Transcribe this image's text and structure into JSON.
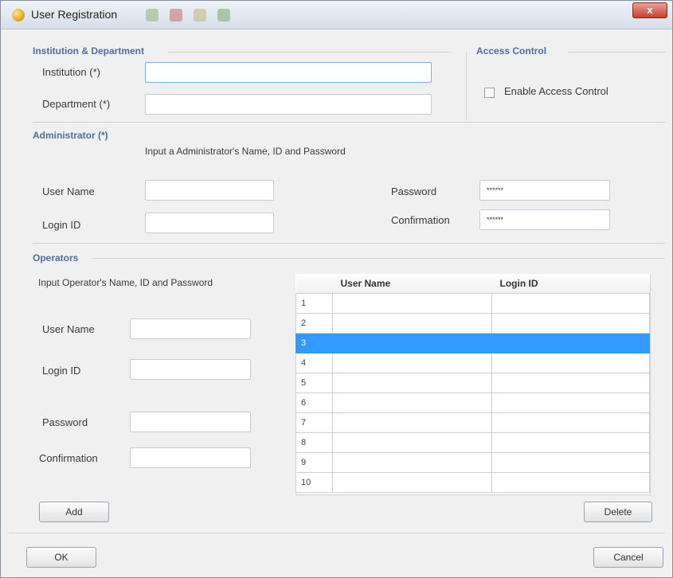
{
  "window": {
    "title": "User Registration",
    "close_label": "x"
  },
  "institution_dept": {
    "group_label": "Institution & Department",
    "institution_label": "Institution (*)",
    "institution_value": "",
    "department_label": "Department (*)",
    "department_value": ""
  },
  "access_control": {
    "group_label": "Access Control",
    "enable_label": "Enable Access Control",
    "checked": false
  },
  "administrator": {
    "group_label": "Administrator (*)",
    "hint": "Input a Administrator's Name, ID and Password",
    "username_label": "User Name",
    "loginid_label": "Login ID",
    "password_label": "Password",
    "confirmation_label": "Confirmation",
    "password_value": "******",
    "confirmation_value": "******"
  },
  "operators": {
    "group_label": "Operators",
    "hint": "Input Operator's Name, ID and Password",
    "username_label": "User Name",
    "loginid_label": "Login ID",
    "password_label": "Password",
    "confirmation_label": "Confirmation",
    "add_label": "Add",
    "delete_label": "Delete",
    "table": {
      "columns": [
        "User Name",
        "Login ID"
      ],
      "rows": [
        {
          "num": "1",
          "user": "",
          "login": ""
        },
        {
          "num": "2",
          "user": "",
          "login": ""
        },
        {
          "num": "3",
          "user": "",
          "login": ""
        },
        {
          "num": "4",
          "user": "",
          "login": ""
        },
        {
          "num": "5",
          "user": "",
          "login": ""
        },
        {
          "num": "6",
          "user": "",
          "login": ""
        },
        {
          "num": "7",
          "user": "",
          "login": ""
        },
        {
          "num": "8",
          "user": "",
          "login": ""
        },
        {
          "num": "9",
          "user": "",
          "login": ""
        },
        {
          "num": "10",
          "user": "",
          "login": ""
        }
      ],
      "selected_row": "3"
    }
  },
  "footer": {
    "ok_label": "OK",
    "cancel_label": "Cancel"
  }
}
